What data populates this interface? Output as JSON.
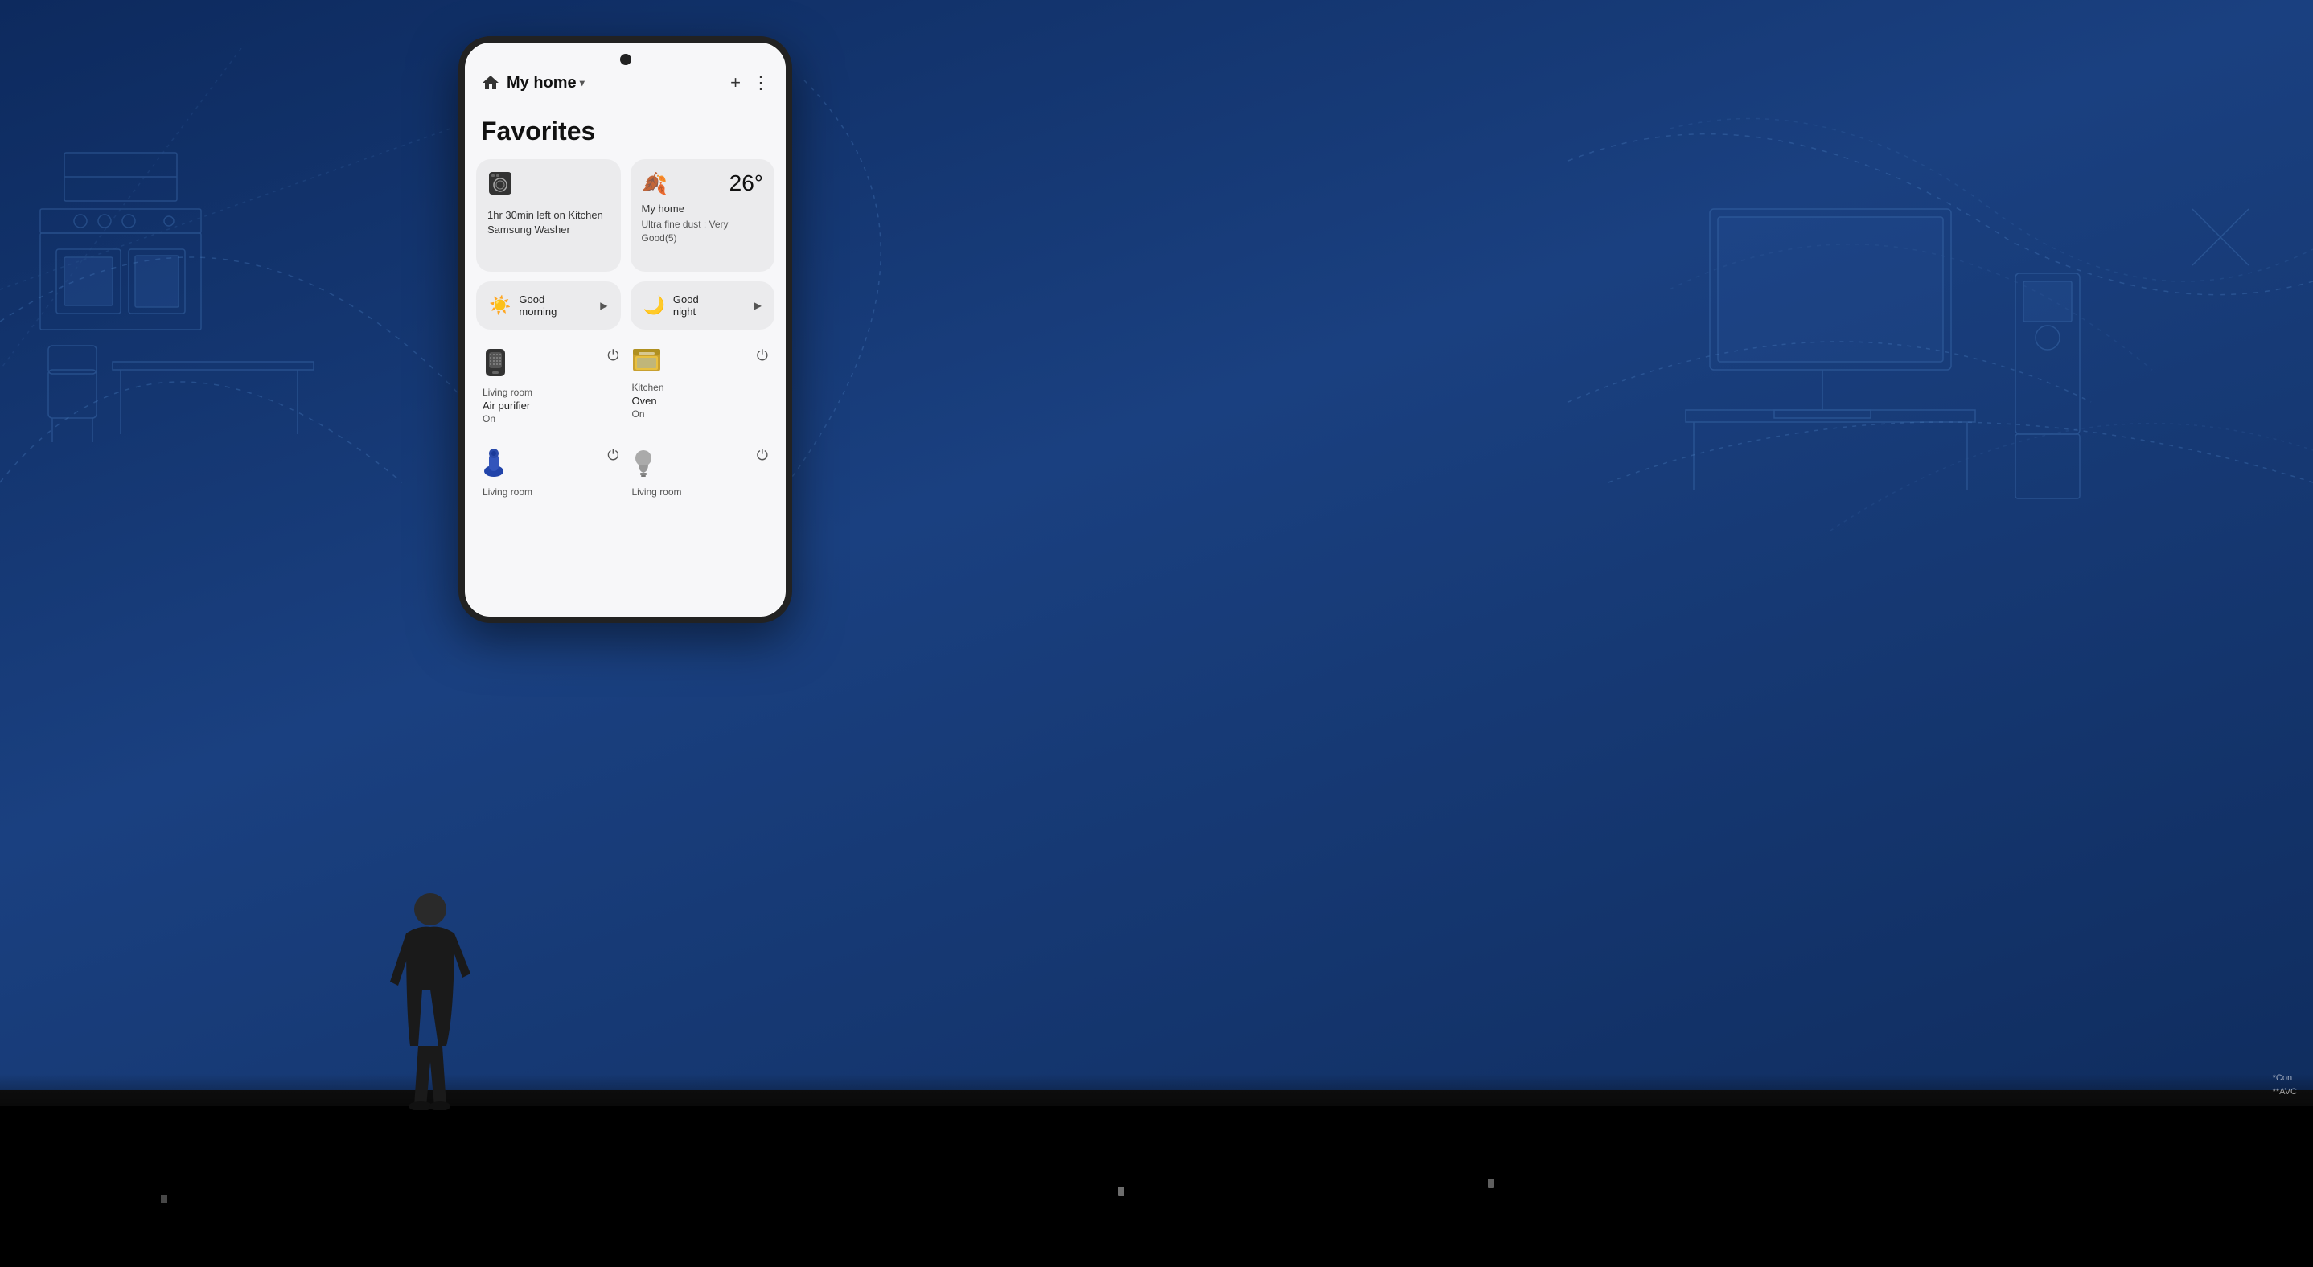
{
  "stage": {
    "background_color": "#1a3a6b"
  },
  "phone": {
    "title": "My home",
    "dropdown_arrow": "▾",
    "add_btn": "+",
    "more_btn": "⋮",
    "favorites_label": "Favorites",
    "washer_card": {
      "icon": "🫧",
      "text": "1hr 30min left on Kitchen Samsung Washer"
    },
    "weather_card": {
      "icon": "🍂",
      "temp": "26°",
      "location": "My home",
      "detail": "Ultra fine dust : Very Good(5)"
    },
    "scenes": [
      {
        "icon": "☀️",
        "label": "Good\nmorning",
        "play": "▶"
      },
      {
        "icon": "🌙",
        "label": "Good\nnight",
        "play": "▶"
      }
    ],
    "devices": [
      {
        "icon": "💨",
        "room": "Living room",
        "name": "Air purifier",
        "status": "On",
        "power": "⏻"
      },
      {
        "icon": "📦",
        "room": "Kitchen",
        "name": "Oven",
        "status": "On",
        "power": "⏻"
      }
    ],
    "bottom_devices": [
      {
        "icon": "🫙",
        "room": "Living room",
        "name": "",
        "status": "",
        "power": "⏻"
      },
      {
        "icon": "💡",
        "room": "Living room",
        "name": "",
        "status": "",
        "power": "⏻"
      }
    ]
  },
  "footnote": {
    "line1": "*Con",
    "line2": "**AVC"
  }
}
